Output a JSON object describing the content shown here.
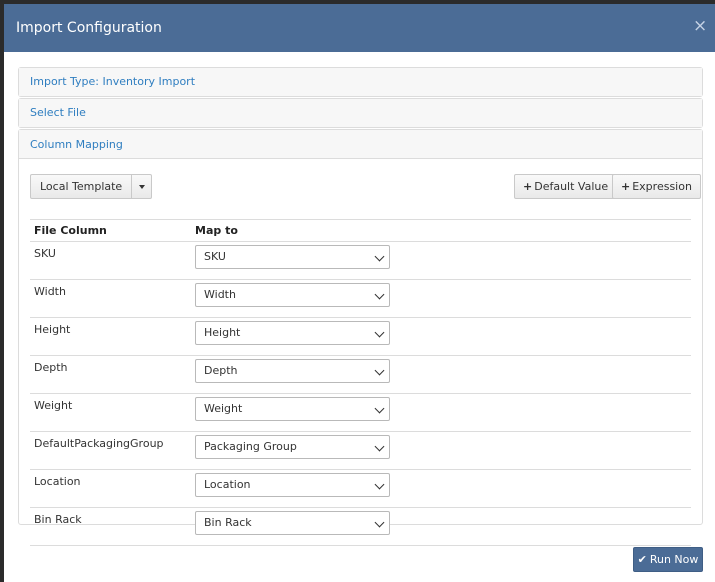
{
  "modal": {
    "title": "Import Configuration",
    "close_symbol": "×"
  },
  "panels": {
    "import_type": "Import Type: Inventory Import",
    "select_file": "Select File",
    "column_mapping": "Column Mapping"
  },
  "toolbar": {
    "template_label": "Local Template",
    "default_value_label": "Default Value",
    "expression_label": "Expression"
  },
  "table": {
    "headers": [
      "File Column",
      "Map to"
    ],
    "rows": [
      {
        "file_column": "SKU",
        "map_to": "SKU"
      },
      {
        "file_column": "Width",
        "map_to": "Width"
      },
      {
        "file_column": "Height",
        "map_to": "Height"
      },
      {
        "file_column": "Depth",
        "map_to": "Depth"
      },
      {
        "file_column": "Weight",
        "map_to": "Weight"
      },
      {
        "file_column": "DefaultPackagingGroup",
        "map_to": "Packaging Group"
      },
      {
        "file_column": "Location",
        "map_to": "Location"
      },
      {
        "file_column": "Bin Rack",
        "map_to": "Bin Rack"
      }
    ]
  },
  "footer": {
    "run_label": "Run Now"
  },
  "icons": {
    "close": "close-icon",
    "plus": "plus-icon",
    "check": "check-icon",
    "dropdown": "chevron-down-icon"
  },
  "colors": {
    "header_bg": "#4b6c96",
    "link": "#2f7ec0",
    "primary_button": "#4b6c96"
  }
}
